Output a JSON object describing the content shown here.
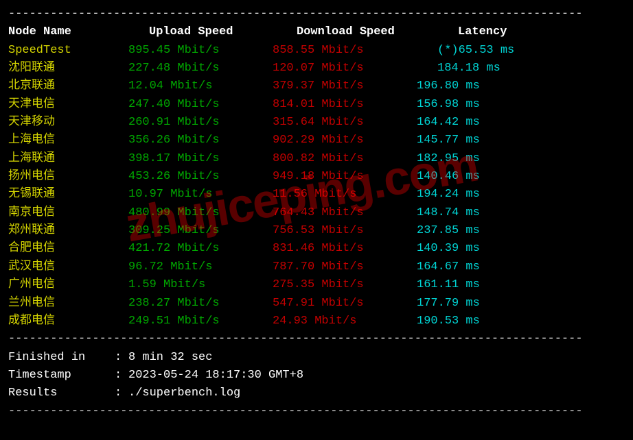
{
  "headers": {
    "node": "Node Name",
    "upload": "Upload Speed",
    "download": "Download Speed",
    "latency": "Latency"
  },
  "speedtest_row": {
    "node": "SpeedTest",
    "upload": "895.45 Mbit/s",
    "download": "858.55 Mbit/s",
    "latency": "(*)65.53 ms"
  },
  "rows": [
    {
      "node": "沈阳联通",
      "upload": "227.48 Mbit/s",
      "download": "120.07 Mbit/s",
      "latency": "184.18 ms"
    },
    {
      "node": "北京联通",
      "upload": "12.04 Mbit/s",
      "download": "379.37 Mbit/s",
      "latency": "196.80 ms"
    },
    {
      "node": "天津电信",
      "upload": "247.40 Mbit/s",
      "download": "814.01 Mbit/s",
      "latency": "156.98 ms"
    },
    {
      "node": "天津移动",
      "upload": "260.91 Mbit/s",
      "download": "315.64 Mbit/s",
      "latency": "164.42 ms"
    },
    {
      "node": "上海电信",
      "upload": "356.26 Mbit/s",
      "download": "902.29 Mbit/s",
      "latency": "145.77 ms"
    },
    {
      "node": "上海联通",
      "upload": "398.17 Mbit/s",
      "download": "800.82 Mbit/s",
      "latency": "182.95 ms"
    },
    {
      "node": "扬州电信",
      "upload": "453.26 Mbit/s",
      "download": "949.18 Mbit/s",
      "latency": "140.46 ms"
    },
    {
      "node": "无锡联通",
      "upload": "10.97 Mbit/s",
      "download": "11.56 Mbit/s",
      "latency": "194.24 ms"
    },
    {
      "node": "南京电信",
      "upload": "480.99 Mbit/s",
      "download": "764.43 Mbit/s",
      "latency": "148.74 ms"
    },
    {
      "node": "郑州联通",
      "upload": "309.25 Mbit/s",
      "download": "756.53 Mbit/s",
      "latency": "237.85 ms"
    },
    {
      "node": "合肥电信",
      "upload": "421.72 Mbit/s",
      "download": "831.46 Mbit/s",
      "latency": "140.39 ms"
    },
    {
      "node": "武汉电信",
      "upload": "96.72 Mbit/s",
      "download": "787.70 Mbit/s",
      "latency": "164.67 ms"
    },
    {
      "node": "广州电信",
      "upload": "1.59 Mbit/s",
      "download": "275.35 Mbit/s",
      "latency": "161.11 ms"
    },
    {
      "node": "兰州电信",
      "upload": "238.27 Mbit/s",
      "download": "547.91 Mbit/s",
      "latency": "177.79 ms"
    },
    {
      "node": "成都电信",
      "upload": "249.51 Mbit/s",
      "download": "24.93 Mbit/s",
      "latency": "190.53 ms"
    }
  ],
  "footer": {
    "finished_label": "Finished in",
    "finished_value": "8 min 32 sec",
    "timestamp_label": "Timestamp",
    "timestamp_value": "2023-05-24 18:17:30 GMT+8",
    "results_label": "Results",
    "results_value": "./superbench.log",
    "sep": ":"
  },
  "divider": "----------------------------------------------------------------------------------",
  "watermark": "zhujiceping.com"
}
